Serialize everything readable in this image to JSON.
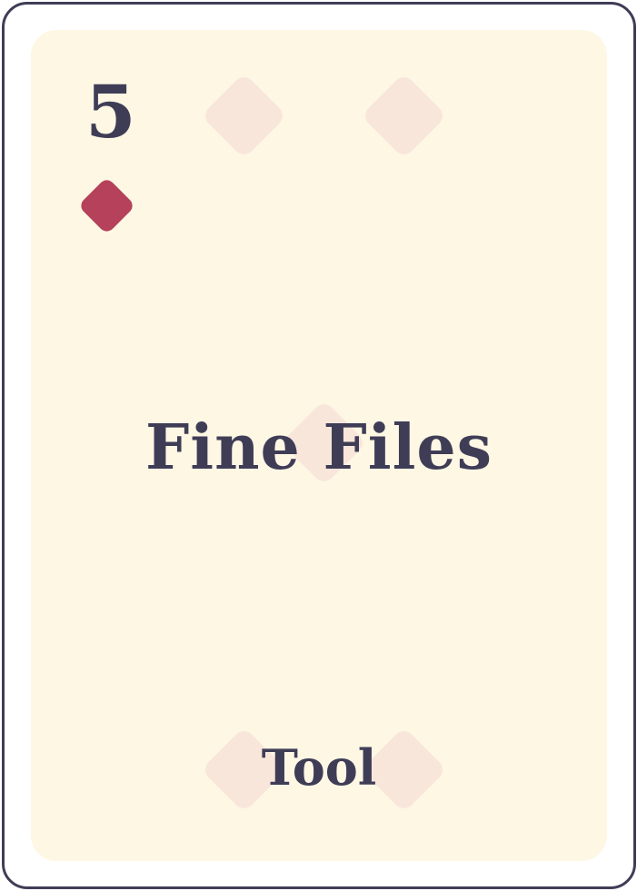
{
  "card": {
    "rank": "5",
    "suit": "diamond",
    "title": "Fine Files",
    "type": "Tool",
    "colors": {
      "ink": "#3f3d56",
      "suit": "#b5415a",
      "face": "#fdf7e4",
      "pip": "#f9e6db",
      "border": "#3f3d56"
    },
    "pip_count": 5
  }
}
